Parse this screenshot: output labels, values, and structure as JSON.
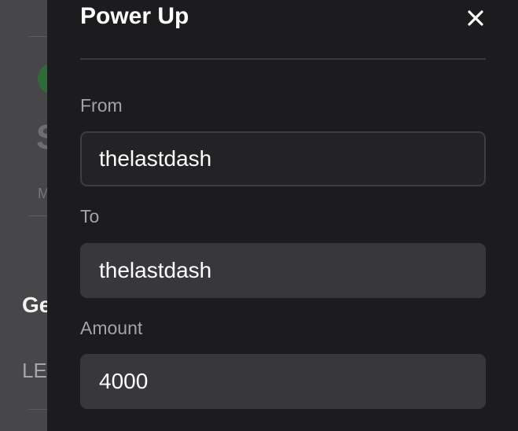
{
  "backdrop": {
    "big_char": "S",
    "small_char": "M",
    "section_heading": "Ge",
    "list_item": "LE"
  },
  "dialog": {
    "title": "Power Up",
    "close_icon": "close-icon",
    "fields": {
      "from": {
        "label": "From",
        "value": "thelastdash"
      },
      "to": {
        "label": "To",
        "value": "thelastdash"
      },
      "amount": {
        "label": "Amount",
        "value": "4000"
      }
    }
  },
  "colors": {
    "panel_bg": "#1c1c1f",
    "backdrop_bg": "#47474a",
    "input_bg": "#232326",
    "readonly_bg": "#38383c",
    "label": "#a3a3a8",
    "text": "#ffffff"
  }
}
